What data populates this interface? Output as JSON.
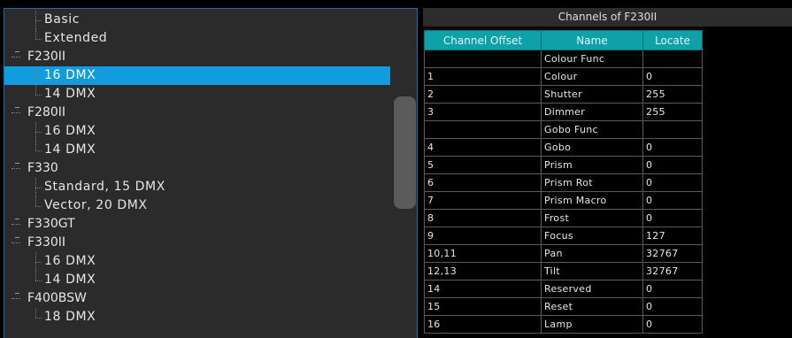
{
  "tree": [
    {
      "label": "Basic",
      "level": 1
    },
    {
      "label": "Extended",
      "level": 1
    },
    {
      "label": "F230II",
      "level": 0
    },
    {
      "label": "16 DMX",
      "level": 1,
      "selected": true
    },
    {
      "label": "14 DMX",
      "level": 1
    },
    {
      "label": "F280II",
      "level": 0
    },
    {
      "label": "16 DMX",
      "level": 1
    },
    {
      "label": "14 DMX",
      "level": 1
    },
    {
      "label": "F330",
      "level": 0
    },
    {
      "label": "Standard, 15 DMX",
      "level": 1
    },
    {
      "label": "Vector, 20 DMX",
      "level": 1
    },
    {
      "label": "F330GT",
      "level": 0
    },
    {
      "label": "F330II",
      "level": 0
    },
    {
      "label": "16 DMX",
      "level": 1
    },
    {
      "label": "14 DMX",
      "level": 1
    },
    {
      "label": "F400BSW",
      "level": 0
    },
    {
      "label": "18 DMX",
      "level": 1
    }
  ],
  "channels": {
    "title": "Channels of F230II",
    "headers": [
      "Channel Offset",
      "Name",
      "Locate"
    ],
    "rows": [
      [
        "",
        "Colour Func",
        ""
      ],
      [
        "1",
        "Colour",
        "0"
      ],
      [
        "2",
        "Shutter",
        "255"
      ],
      [
        "3",
        "Dimmer",
        "255"
      ],
      [
        "",
        "Gobo Func",
        ""
      ],
      [
        "4",
        "Gobo",
        "0"
      ],
      [
        "5",
        "Prism",
        "0"
      ],
      [
        "6",
        "Prism Rot",
        "0"
      ],
      [
        "7",
        "Prism Macro",
        "0"
      ],
      [
        "8",
        "Frost",
        "0"
      ],
      [
        "9",
        "Focus",
        "127"
      ],
      [
        "10,11",
        "Pan",
        "32767"
      ],
      [
        "12,13",
        "Tilt",
        "32767"
      ],
      [
        "14",
        "Reserved",
        "0"
      ],
      [
        "15",
        "Reset",
        "0"
      ],
      [
        "16",
        "Lamp",
        "0"
      ]
    ]
  },
  "colors": {
    "selection": "#119ce0",
    "header": "#0ea2a8",
    "panel": "#2b2b2b"
  }
}
